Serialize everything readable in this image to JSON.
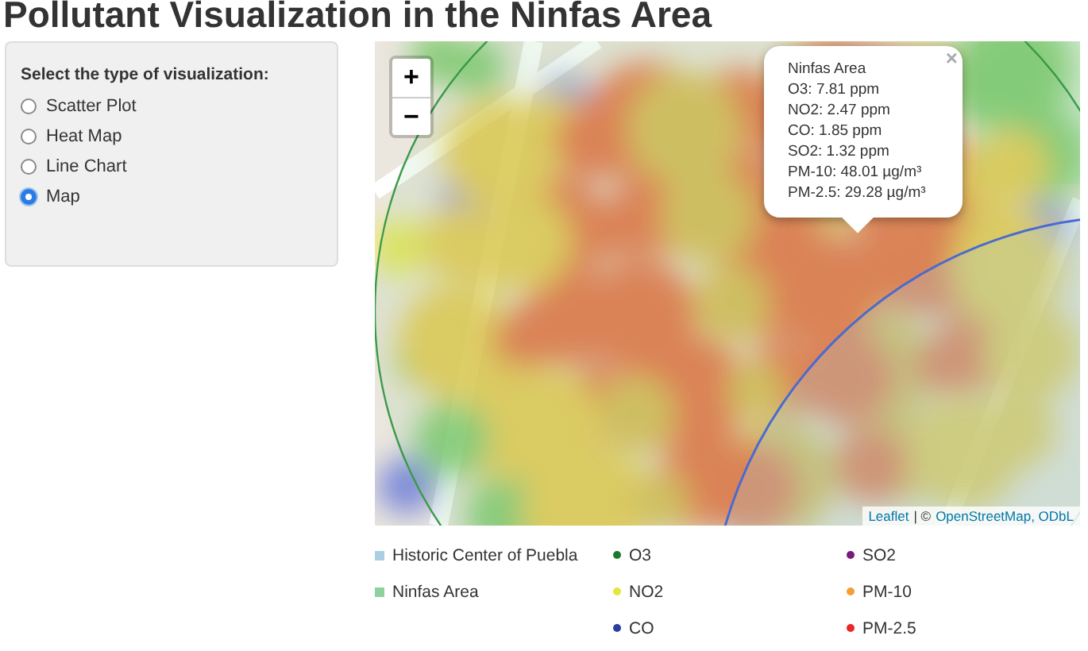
{
  "title": "Pollutant Visualization in the Ninfas Area",
  "sidebar": {
    "label": "Select the type of visualization:",
    "options": [
      {
        "label": "Scatter Plot",
        "selected": false
      },
      {
        "label": "Heat Map",
        "selected": false
      },
      {
        "label": "Line Chart",
        "selected": false
      },
      {
        "label": "Map",
        "selected": true
      }
    ]
  },
  "map": {
    "zoom_in": "+",
    "zoom_out": "−",
    "popup": {
      "close": "×",
      "title": "Ninfas Area",
      "lines": [
        "O3: 7.81 ppm",
        "NO2: 2.47 ppm",
        "CO: 1.85 ppm",
        "SO2: 1.32 ppm",
        "PM-10: 48.01 µg/m³",
        "PM-2.5: 29.28 µg/m³"
      ]
    },
    "attribution": [
      {
        "kind": "link",
        "text": "Leaflet"
      },
      {
        "kind": "text",
        "text": "| ©"
      },
      {
        "kind": "link",
        "text": "OpenStreetMap, ODbL"
      }
    ]
  },
  "legend": {
    "areas": [
      {
        "label": "Historic Center of Puebla",
        "color": "#a9cfe0"
      },
      {
        "label": "Ninfas Area",
        "color": "#8fd19e"
      }
    ],
    "pollutants": [
      {
        "label": "O3",
        "color": "#1b7a2e"
      },
      {
        "label": "NO2",
        "color": "#e6e63a"
      },
      {
        "label": "CO",
        "color": "#2b3fa0"
      },
      {
        "label": "SO2",
        "color": "#7a1a78"
      },
      {
        "label": "PM-10",
        "color": "#f4a032"
      },
      {
        "label": "PM-2.5",
        "color": "#e8282c"
      }
    ]
  }
}
